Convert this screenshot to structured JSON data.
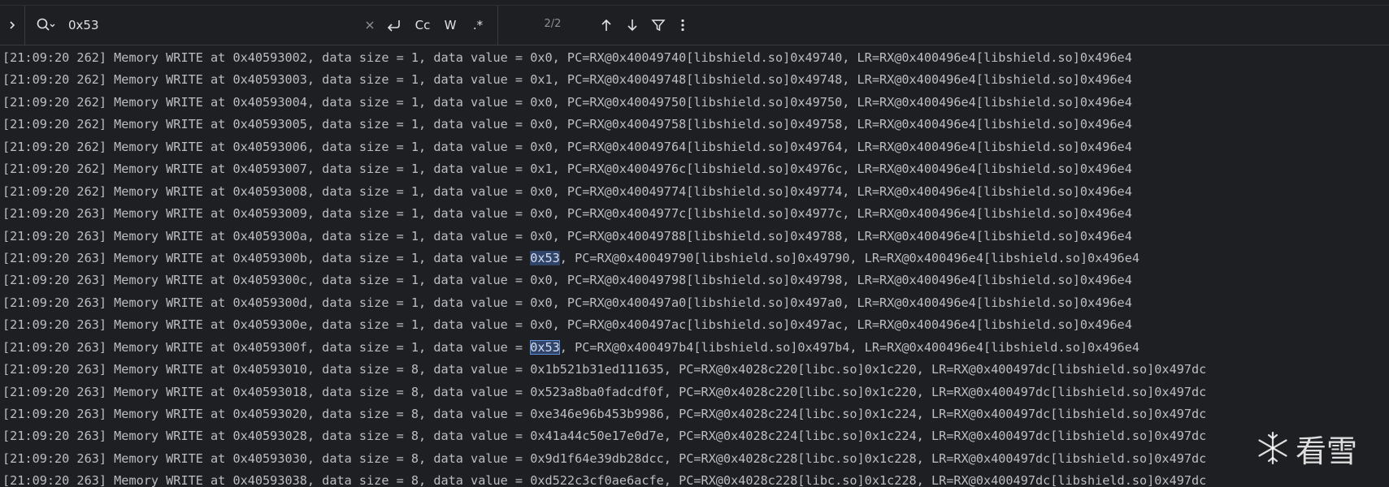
{
  "find_bar": {
    "query": "0x53",
    "match_count": "2/2",
    "case_label": "Cc",
    "word_label": "W",
    "regex_label": ".*",
    "clear_icon": "close-icon",
    "expand_icon": "chevron-right-icon",
    "search_icon": "search-history-icon",
    "newline_icon": "new-line-icon",
    "prev_icon": "arrow-up-icon",
    "next_icon": "arrow-down-icon",
    "filter_icon": "filter-icon",
    "more_icon": "more-vertical-icon"
  },
  "colors": {
    "background": "#1e1f22",
    "text": "#bcbec4",
    "match_highlight": "#2f4468",
    "current_match_border": "#5f8ed6"
  },
  "log_lines": [
    {
      "before": "[21:09:20 262] Memory WRITE at 0x40593002, data size = 1, data value = ",
      "match": "",
      "value": "0x0",
      "after": ", PC=RX@0x40049740[libshield.so]0x49740, LR=RX@0x400496e4[libshield.so]0x496e4"
    },
    {
      "before": "[21:09:20 262] Memory WRITE at 0x40593003, data size = 1, data value = ",
      "match": "",
      "value": "0x1",
      "after": ", PC=RX@0x40049748[libshield.so]0x49748, LR=RX@0x400496e4[libshield.so]0x496e4"
    },
    {
      "before": "[21:09:20 262] Memory WRITE at 0x40593004, data size = 1, data value = ",
      "match": "",
      "value": "0x0",
      "after": ", PC=RX@0x40049750[libshield.so]0x49750, LR=RX@0x400496e4[libshield.so]0x496e4"
    },
    {
      "before": "[21:09:20 262] Memory WRITE at 0x40593005, data size = 1, data value = ",
      "match": "",
      "value": "0x0",
      "after": ", PC=RX@0x40049758[libshield.so]0x49758, LR=RX@0x400496e4[libshield.so]0x496e4"
    },
    {
      "before": "[21:09:20 262] Memory WRITE at 0x40593006, data size = 1, data value = ",
      "match": "",
      "value": "0x0",
      "after": ", PC=RX@0x40049764[libshield.so]0x49764, LR=RX@0x400496e4[libshield.so]0x496e4"
    },
    {
      "before": "[21:09:20 262] Memory WRITE at 0x40593007, data size = 1, data value = ",
      "match": "",
      "value": "0x1",
      "after": ", PC=RX@0x4004976c[libshield.so]0x4976c, LR=RX@0x400496e4[libshield.so]0x496e4"
    },
    {
      "before": "[21:09:20 262] Memory WRITE at 0x40593008, data size = 1, data value = ",
      "match": "",
      "value": "0x0",
      "after": ", PC=RX@0x40049774[libshield.so]0x49774, LR=RX@0x400496e4[libshield.so]0x496e4"
    },
    {
      "before": "[21:09:20 263] Memory WRITE at 0x40593009, data size = 1, data value = ",
      "match": "",
      "value": "0x0",
      "after": ", PC=RX@0x4004977c[libshield.so]0x4977c, LR=RX@0x400496e4[libshield.so]0x496e4"
    },
    {
      "before": "[21:09:20 263] Memory WRITE at 0x4059300a, data size = 1, data value = ",
      "match": "",
      "value": "0x0",
      "after": ", PC=RX@0x40049788[libshield.so]0x49788, LR=RX@0x400496e4[libshield.so]0x496e4"
    },
    {
      "before": "[21:09:20 263] Memory WRITE at 0x4059300b, data size = 1, data value = ",
      "match": "highlight",
      "value": "0x53",
      "after": ", PC=RX@0x40049790[libshield.so]0x49790, LR=RX@0x400496e4[libshield.so]0x496e4"
    },
    {
      "before": "[21:09:20 263] Memory WRITE at 0x4059300c, data size = 1, data value = ",
      "match": "",
      "value": "0x0",
      "after": ", PC=RX@0x40049798[libshield.so]0x49798, LR=RX@0x400496e4[libshield.so]0x496e4"
    },
    {
      "before": "[21:09:20 263] Memory WRITE at 0x4059300d, data size = 1, data value = ",
      "match": "",
      "value": "0x0",
      "after": ", PC=RX@0x400497a0[libshield.so]0x497a0, LR=RX@0x400496e4[libshield.so]0x496e4"
    },
    {
      "before": "[21:09:20 263] Memory WRITE at 0x4059300e, data size = 1, data value = ",
      "match": "",
      "value": "0x0",
      "after": ", PC=RX@0x400497ac[libshield.so]0x497ac, LR=RX@0x400496e4[libshield.so]0x496e4"
    },
    {
      "before": "[21:09:20 263] Memory WRITE at 0x4059300f, data size = 1, data value = ",
      "match": "current",
      "value": "0x53",
      "after": ", PC=RX@0x400497b4[libshield.so]0x497b4, LR=RX@0x400496e4[libshield.so]0x496e4"
    },
    {
      "before": "[21:09:20 263] Memory WRITE at 0x40593010, data size = 8, data value = ",
      "match": "",
      "value": "0x1b521b31ed111635",
      "after": ", PC=RX@0x4028c220[libc.so]0x1c220, LR=RX@0x400497dc[libshield.so]0x497dc"
    },
    {
      "before": "[21:09:20 263] Memory WRITE at 0x40593018, data size = 8, data value = ",
      "match": "",
      "value": "0x523a8ba0fadcdf0f",
      "after": ", PC=RX@0x4028c220[libc.so]0x1c220, LR=RX@0x400497dc[libshield.so]0x497dc"
    },
    {
      "before": "[21:09:20 263] Memory WRITE at 0x40593020, data size = 8, data value = ",
      "match": "",
      "value": "0xe346e96b453b9986",
      "after": ", PC=RX@0x4028c224[libc.so]0x1c224, LR=RX@0x400497dc[libshield.so]0x497dc"
    },
    {
      "before": "[21:09:20 263] Memory WRITE at 0x40593028, data size = 8, data value = ",
      "match": "",
      "value": "0x41a44c50e17e0d7e",
      "after": ", PC=RX@0x4028c224[libc.so]0x1c224, LR=RX@0x400497dc[libshield.so]0x497dc"
    },
    {
      "before": "[21:09:20 263] Memory WRITE at 0x40593030, data size = 8, data value = ",
      "match": "",
      "value": "0x9d1f64e39db28dcc",
      "after": ", PC=RX@0x4028c228[libc.so]0x1c228, LR=RX@0x400497dc[libshield.so]0x497dc"
    },
    {
      "before": "[21:09:20 263] Memory WRITE at 0x40593038, data size = 8, data value = ",
      "match": "",
      "value": "0xd522c3cf0ae6acfe",
      "after": ", PC=RX@0x4028c228[libc.so]0x1c228, LR=RX@0x400497dc[libshield.so]0x497dc"
    }
  ],
  "watermark": {
    "text": "看雪",
    "icon": "snowflake-icon"
  }
}
